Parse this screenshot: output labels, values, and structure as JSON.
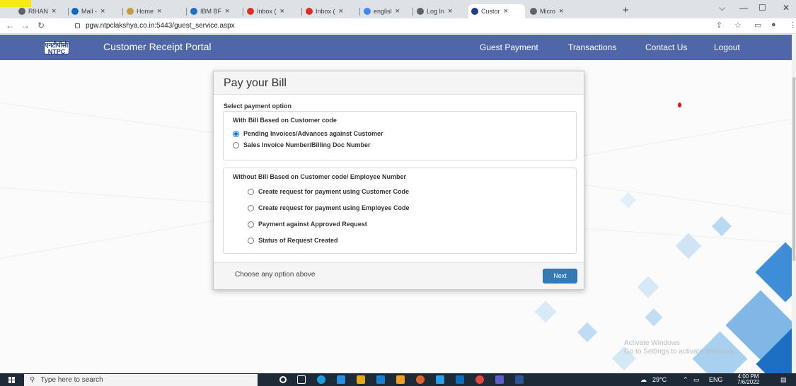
{
  "browser": {
    "tabs": [
      {
        "label": "RIHAN",
        "icon": "globe-icon",
        "color": "#5f6368"
      },
      {
        "label": "Mail -",
        "icon": "outlook-icon",
        "color": "#0f6cbd"
      },
      {
        "label": "Home",
        "icon": "teams-icon",
        "color": "#c89b3c"
      },
      {
        "label": "IBM BF",
        "icon": "ibm-icon",
        "color": "#1f70c1"
      },
      {
        "label": "Inbox (",
        "icon": "gmail-icon",
        "color": "#d93025"
      },
      {
        "label": "Inbox (",
        "icon": "gmail-icon",
        "color": "#d93025"
      },
      {
        "label": "englisl",
        "icon": "google-icon",
        "color": "#4285f4"
      },
      {
        "label": "Log In",
        "icon": "globe-icon",
        "color": "#5f6368"
      },
      {
        "label": "Custor",
        "icon": "ntpc-icon",
        "color": "#1f3c88",
        "active": true
      },
      {
        "label": "Micro",
        "icon": "globe-icon",
        "color": "#5f6368"
      }
    ],
    "close_glyph": "×",
    "new_tab_glyph": "+",
    "url": "pgw.ntpclakshya.co.in:5443/guest_service.aspx",
    "window_controls": {
      "minimize": "—",
      "maximize": "☐",
      "close": "✕",
      "chevron": "⌵"
    }
  },
  "app": {
    "logo_text_line1": "एनटीपीसी",
    "logo_text_line2": "NTPC",
    "title": "Customer Receipt Portal",
    "nav": [
      "Guest Payment",
      "Transactions",
      "Contact Us",
      "Logout"
    ],
    "header_color": "#4f66a8"
  },
  "modal": {
    "title": "Pay your Bill",
    "select_label": "Select payment option",
    "group1": {
      "legend": "With Bill Based on Customer code",
      "options": [
        {
          "label": "Pending Invoices/Advances against Customer",
          "checked": true
        },
        {
          "label": "Sales Invoice Number/Billing Doc Number",
          "checked": false
        }
      ]
    },
    "group2": {
      "legend": "Without Bill Based on Customer code/ Employee Number",
      "options": [
        {
          "label": "Create request for payment using Customer Code",
          "checked": false
        },
        {
          "label": "Create request for payment using Employee Code",
          "checked": false
        },
        {
          "label": "Payment against Approved Request",
          "checked": false
        },
        {
          "label": "Status of Request Created",
          "checked": false
        }
      ]
    },
    "footer_hint": "Choose any option above",
    "next_label": "Next"
  },
  "watermark": {
    "line1": "Activate Windows",
    "line2": "Go to Settings to activate Windows."
  },
  "taskbar": {
    "search_placeholder": "Type here to search",
    "weather": "29°C",
    "language": "ENG",
    "time": "4:00 PM",
    "date": "7/6/2022"
  }
}
